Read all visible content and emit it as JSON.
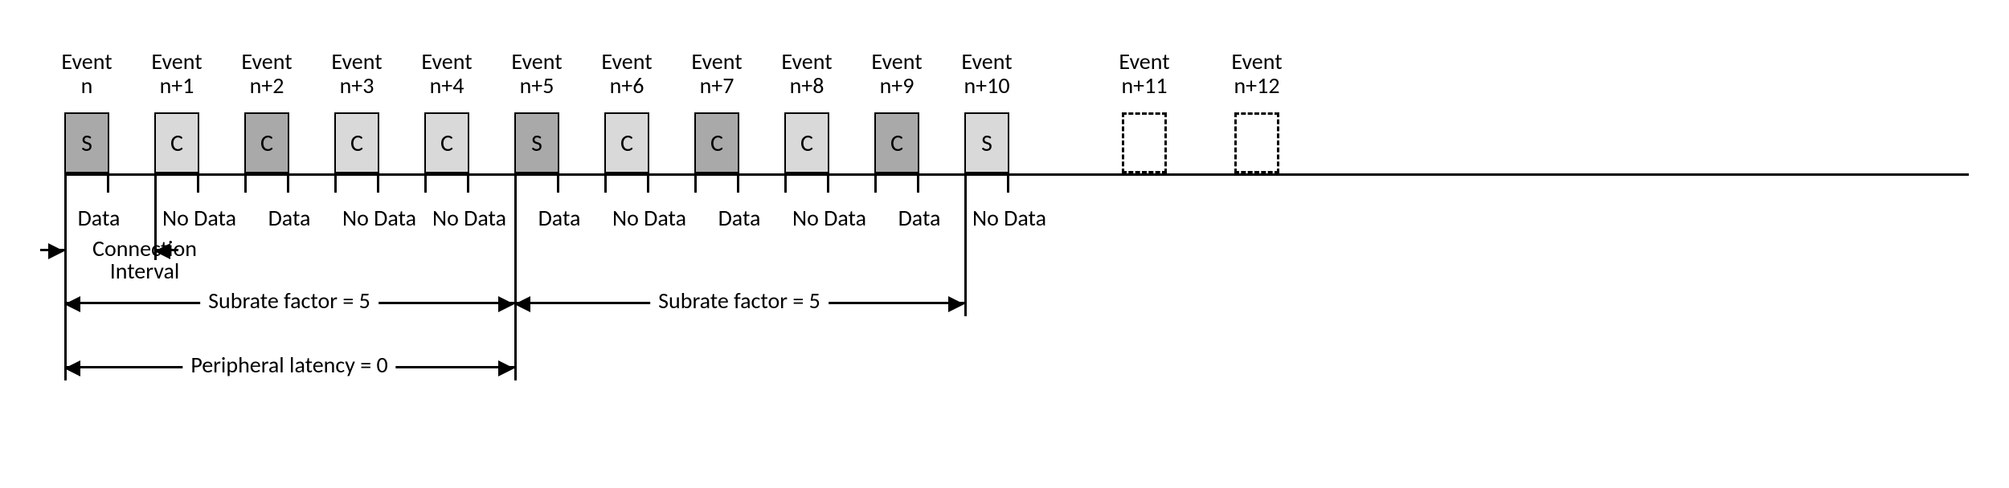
{
  "events": [
    {
      "label_top": "Event",
      "label_bot": "n",
      "letter": "S",
      "shade": "dark",
      "data": "Data"
    },
    {
      "label_top": "Event",
      "label_bot": "n+1",
      "letter": "C",
      "shade": "light",
      "data": "No Data"
    },
    {
      "label_top": "Event",
      "label_bot": "n+2",
      "letter": "C",
      "shade": "dark",
      "data": "Data"
    },
    {
      "label_top": "Event",
      "label_bot": "n+3",
      "letter": "C",
      "shade": "light",
      "data": "No Data"
    },
    {
      "label_top": "Event",
      "label_bot": "n+4",
      "letter": "C",
      "shade": "light",
      "data": "No Data"
    },
    {
      "label_top": "Event",
      "label_bot": "n+5",
      "letter": "S",
      "shade": "dark",
      "data": "Data"
    },
    {
      "label_top": "Event",
      "label_bot": "n+6",
      "letter": "C",
      "shade": "light",
      "data": "No Data"
    },
    {
      "label_top": "Event",
      "label_bot": "n+7",
      "letter": "C",
      "shade": "dark",
      "data": "Data"
    },
    {
      "label_top": "Event",
      "label_bot": "n+8",
      "letter": "C",
      "shade": "light",
      "data": "No Data"
    },
    {
      "label_top": "Event",
      "label_bot": "n+9",
      "letter": "C",
      "shade": "dark",
      "data": "Data"
    },
    {
      "label_top": "Event",
      "label_bot": "n+10",
      "letter": "S",
      "shade": "light",
      "data": "No Data"
    }
  ],
  "dashed_events": [
    {
      "label_top": "Event",
      "label_bot": "n+11"
    },
    {
      "label_top": "Event",
      "label_bot": "n+12"
    }
  ],
  "conn_interval": {
    "line1": "Connection",
    "line2": "Interval"
  },
  "subrate1": "Subrate factor = 5",
  "subrate2": "Subrate factor = 5",
  "latency": "Peripheral latency = 0"
}
